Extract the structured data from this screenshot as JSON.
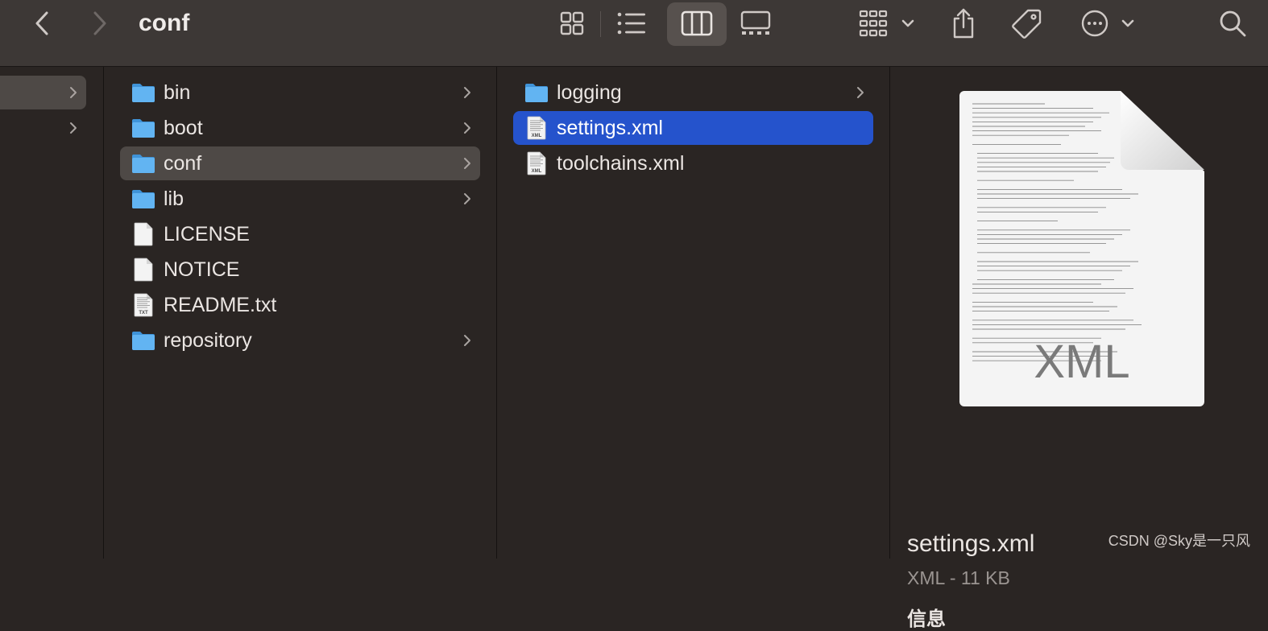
{
  "window": {
    "title": "conf"
  },
  "toolbar": {
    "buttons": [
      {
        "name": "back-button",
        "icon": "chevron-left-icon"
      },
      {
        "name": "forward-button",
        "icon": "chevron-right-icon",
        "disabled": true
      },
      {
        "name": "view-icons-button",
        "icon": "grid-icon"
      },
      {
        "name": "view-list-button",
        "icon": "list-icon"
      },
      {
        "name": "view-columns-button",
        "icon": "columns-icon",
        "selected": true
      },
      {
        "name": "view-gallery-button",
        "icon": "gallery-icon"
      },
      {
        "name": "group-button",
        "icon": "group-grid-icon"
      },
      {
        "name": "share-button",
        "icon": "share-icon"
      },
      {
        "name": "tags-button",
        "icon": "tag-icon"
      },
      {
        "name": "more-button",
        "icon": "ellipsis-icon"
      },
      {
        "name": "search-button",
        "icon": "search-icon"
      }
    ]
  },
  "columns": [
    {
      "items": [
        {
          "label": "",
          "selected_parent": true,
          "has_children": true
        },
        {
          "label": "",
          "has_children": true
        }
      ]
    },
    {
      "items": [
        {
          "label": "bin",
          "kind": "folder",
          "has_children": true
        },
        {
          "label": "boot",
          "kind": "folder",
          "has_children": true
        },
        {
          "label": "conf",
          "kind": "folder",
          "has_children": true,
          "selected_parent": true
        },
        {
          "label": "lib",
          "kind": "folder",
          "has_children": true
        },
        {
          "label": "LICENSE",
          "kind": "file"
        },
        {
          "label": "NOTICE",
          "kind": "file"
        },
        {
          "label": "README.txt",
          "kind": "txt"
        },
        {
          "label": "repository",
          "kind": "folder",
          "has_children": true
        }
      ]
    },
    {
      "items": [
        {
          "label": "logging",
          "kind": "folder",
          "has_children": true
        },
        {
          "label": "settings.xml",
          "kind": "xml",
          "selected": true
        },
        {
          "label": "toolchains.xml",
          "kind": "xml"
        }
      ]
    }
  ],
  "icon_badges": {
    "xml": "XML",
    "txt": "TXT"
  },
  "preview": {
    "file_name": "settings.xml",
    "meta": "XML - 11 KB",
    "section_title": "信息",
    "thumbnail_badge": "XML"
  },
  "watermark": "CSDN @Sky是一只风",
  "colors": {
    "selection": "#2553cc",
    "folder": "#5fb2f0",
    "toolbar_bg": "#3d3836",
    "window_bg": "#2a2523"
  }
}
